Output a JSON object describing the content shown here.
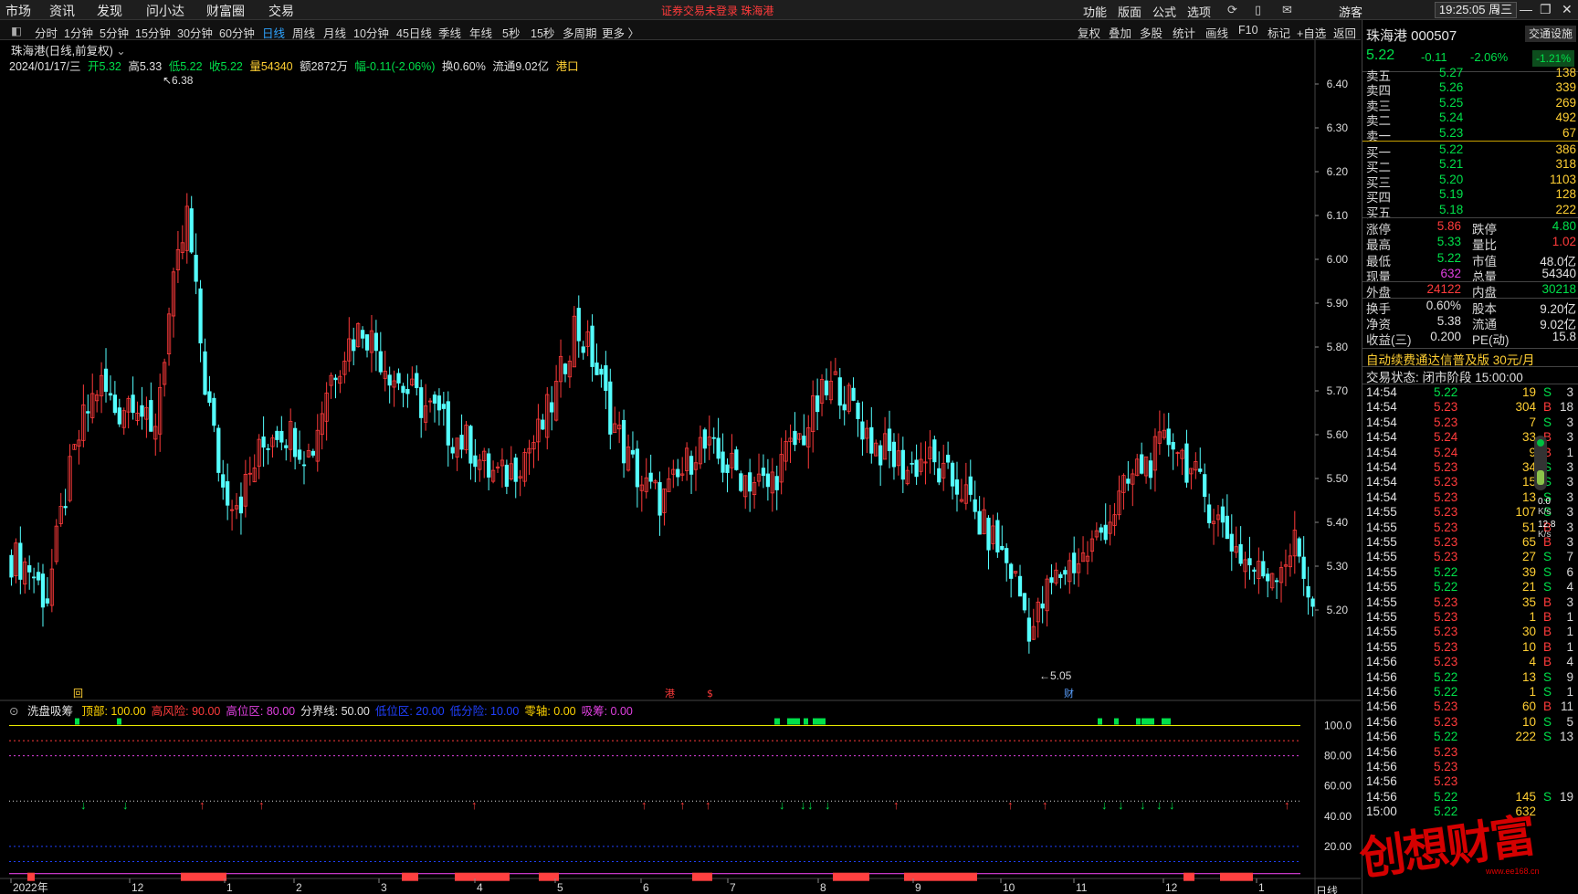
{
  "menu": {
    "left": [
      "市场",
      "资讯",
      "发现",
      "问小达",
      "财富圈",
      "交易"
    ],
    "warning": "证券交易未登录  珠海港",
    "right": [
      "功能",
      "版面",
      "公式",
      "选项"
    ],
    "guest": "游客",
    "clock": "19:25:05 周三"
  },
  "toolbar": {
    "periods": [
      "分时",
      "1分钟",
      "5分钟",
      "15分钟",
      "30分钟",
      "60分钟",
      "日线",
      "周线",
      "月线",
      "10分钟",
      "45日线",
      "季线",
      "年线",
      "5秒",
      "15秒",
      "多周期",
      "更多 〉"
    ],
    "active": "日线",
    "right": [
      "复权",
      "叠加",
      "多股",
      "统计",
      "画线",
      "F10",
      "标记",
      "+自选",
      "返回"
    ]
  },
  "chart": {
    "title": "珠海港(日线,前复权)",
    "date": "2024/01/17/三",
    "open": "开5.32",
    "high": "高5.33",
    "low": "低5.22",
    "close": "收5.22",
    "volume": "量54340",
    "amount": "额2872万",
    "change": "幅-0.11(-2.06%)",
    "turnover": "换0.60%",
    "float": "流通9.02亿",
    "tag": "港口",
    "max_label": "6.38",
    "min_label": "5.05",
    "markers": [
      "回",
      "港",
      "$",
      "财"
    ]
  },
  "indicator": {
    "name": "洗盘吸筹",
    "params": [
      {
        "label": "顶部: 100.00",
        "color": "#ffd400"
      },
      {
        "label": "高风险: 90.00",
        "color": "#ff3b3b"
      },
      {
        "label": "高位区: 80.00",
        "color": "#e040e0"
      },
      {
        "label": "分界线: 50.00",
        "color": "#e0e0e0"
      },
      {
        "label": "低位区: 20.00",
        "color": "#2040ff"
      },
      {
        "label": "低分险: 10.00",
        "color": "#2040ff"
      },
      {
        "label": "零轴: 0.00",
        "color": "#ffd400"
      },
      {
        "label": "吸筹: 0.00",
        "color": "#e040e0"
      }
    ]
  },
  "chart_data": {
    "type": "candlestick",
    "title": "珠海港(日线,前复权)",
    "x_ticks": [
      "2022年",
      "12",
      "1",
      "2",
      "3",
      "4",
      "5",
      "6",
      "7",
      "8",
      "9",
      "10",
      "11",
      "12",
      "1"
    ],
    "ylim": [
      5.0,
      6.45
    ],
    "y_ticks": [
      "6.40",
      "6.30",
      "6.20",
      "6.10",
      "6.00",
      "5.90",
      "5.80",
      "5.70",
      "5.60",
      "5.50",
      "5.40",
      "5.30",
      "5.20"
    ],
    "close_series": [
      5.32,
      5.3,
      5.22,
      5.45,
      5.62,
      5.72,
      5.65,
      5.7,
      5.58,
      5.88,
      6.1,
      5.72,
      5.48,
      5.45,
      5.55,
      5.62,
      5.6,
      5.55,
      5.72,
      5.8,
      5.85,
      5.78,
      5.72,
      5.68,
      5.65,
      5.6,
      5.58,
      5.52,
      5.5,
      5.55,
      5.6,
      5.7,
      5.85,
      5.78,
      5.65,
      5.55,
      5.48,
      5.45,
      5.5,
      5.58,
      5.55,
      5.52,
      5.5,
      5.48,
      5.55,
      5.6,
      5.68,
      5.72,
      5.65,
      5.58,
      5.55,
      5.52,
      5.55,
      5.5,
      5.48,
      5.4,
      5.35,
      5.28,
      5.15,
      5.25,
      5.3,
      5.32,
      5.38,
      5.45,
      5.52,
      5.55,
      5.6,
      5.52,
      5.45,
      5.38,
      5.32,
      5.28,
      5.3,
      5.35,
      5.22
    ],
    "indicator_ylim": [
      0,
      110
    ],
    "indicator_y_ticks": [
      "100.0",
      "80.00",
      "60.00",
      "40.00",
      "20.00"
    ]
  },
  "right": {
    "title": "珠海港 000507",
    "settings": "交通设施",
    "price": "5.22",
    "change": "-0.11",
    "pct": "-2.06%",
    "badge": "-1.21%",
    "asks": [
      {
        "label": "卖五",
        "price": "5.27",
        "vol": "138"
      },
      {
        "label": "卖四",
        "price": "5.26",
        "vol": "339"
      },
      {
        "label": "卖三",
        "price": "5.25",
        "vol": "269"
      },
      {
        "label": "卖二",
        "price": "5.24",
        "vol": "492"
      },
      {
        "label": "卖一",
        "price": "5.23",
        "vol": "67"
      }
    ],
    "bids": [
      {
        "label": "买一",
        "price": "5.22",
        "vol": "386"
      },
      {
        "label": "买二",
        "price": "5.21",
        "vol": "318"
      },
      {
        "label": "买三",
        "price": "5.20",
        "vol": "1103"
      },
      {
        "label": "买四",
        "price": "5.19",
        "vol": "128"
      },
      {
        "label": "买五",
        "price": "5.18",
        "vol": "222"
      }
    ],
    "stats": [
      {
        "a": "涨停",
        "av": "5.86",
        "ac": "red",
        "b": "跌停",
        "bv": "4.80",
        "bc": "green"
      },
      {
        "a": "最高",
        "av": "5.33",
        "ac": "green",
        "b": "量比",
        "bv": "1.02",
        "bc": "red"
      },
      {
        "a": "最低",
        "av": "5.22",
        "ac": "green",
        "b": "市值",
        "bv": "48.0亿",
        "bc": "white"
      },
      {
        "a": "现量",
        "av": "632",
        "ac": "purple",
        "b": "总量",
        "bv": "54340",
        "bc": "white"
      },
      {
        "a": "外盘",
        "av": "24122",
        "ac": "red",
        "b": "内盘",
        "bv": "30218",
        "bc": "green"
      },
      {
        "a": "换手",
        "av": "0.60%",
        "ac": "white",
        "b": "股本",
        "bv": "9.20亿",
        "bc": "white"
      },
      {
        "a": "净资",
        "av": "5.38",
        "ac": "white",
        "b": "流通",
        "bv": "9.02亿",
        "bc": "white"
      },
      {
        "a": "收益(三)",
        "av": "0.200",
        "ac": "white",
        "b": "PE(动)",
        "bv": "15.8",
        "bc": "white"
      }
    ],
    "promo": "自动续费通达信普及版  30元/月",
    "status": "交易状态: 闭市阶段 15:00:00",
    "trades": [
      {
        "t": "14:54",
        "p": "5.22",
        "v": "19",
        "bs": "S",
        "n": "3"
      },
      {
        "t": "14:54",
        "p": "5.23",
        "v": "304",
        "bs": "B",
        "n": "18"
      },
      {
        "t": "14:54",
        "p": "5.23",
        "v": "7",
        "bs": "S",
        "n": "3"
      },
      {
        "t": "14:54",
        "p": "5.24",
        "v": "33",
        "bs": "B",
        "n": "3"
      },
      {
        "t": "14:54",
        "p": "5.24",
        "v": "9",
        "bs": "B",
        "n": "1"
      },
      {
        "t": "14:54",
        "p": "5.23",
        "v": "34",
        "bs": "S",
        "n": "3"
      },
      {
        "t": "14:54",
        "p": "5.23",
        "v": "15",
        "bs": "S",
        "n": "3"
      },
      {
        "t": "14:54",
        "p": "5.23",
        "v": "13",
        "bs": "S",
        "n": "3"
      },
      {
        "t": "14:55",
        "p": "5.23",
        "v": "107",
        "bs": "S",
        "n": "3"
      },
      {
        "t": "14:55",
        "p": "5.23",
        "v": "51",
        "bs": "B",
        "n": "3"
      },
      {
        "t": "14:55",
        "p": "5.23",
        "v": "65",
        "bs": "B",
        "n": "3"
      },
      {
        "t": "14:55",
        "p": "5.23",
        "v": "27",
        "bs": "S",
        "n": "7"
      },
      {
        "t": "14:55",
        "p": "5.22",
        "v": "39",
        "bs": "S",
        "n": "6"
      },
      {
        "t": "14:55",
        "p": "5.22",
        "v": "21",
        "bs": "S",
        "n": "4"
      },
      {
        "t": "14:55",
        "p": "5.23",
        "v": "35",
        "bs": "B",
        "n": "3"
      },
      {
        "t": "14:55",
        "p": "5.23",
        "v": "1",
        "bs": "B",
        "n": "1"
      },
      {
        "t": "14:55",
        "p": "5.23",
        "v": "30",
        "bs": "B",
        "n": "1"
      },
      {
        "t": "14:55",
        "p": "5.23",
        "v": "10",
        "bs": "B",
        "n": "1"
      },
      {
        "t": "14:56",
        "p": "5.23",
        "v": "4",
        "bs": "B",
        "n": "4"
      },
      {
        "t": "14:56",
        "p": "5.22",
        "v": "13",
        "bs": "S",
        "n": "9"
      },
      {
        "t": "14:56",
        "p": "5.22",
        "v": "1",
        "bs": "S",
        "n": "1"
      },
      {
        "t": "14:56",
        "p": "5.23",
        "v": "60",
        "bs": "B",
        "n": "11"
      },
      {
        "t": "14:56",
        "p": "5.23",
        "v": "10",
        "bs": "S",
        "n": "5"
      },
      {
        "t": "14:56",
        "p": "5.22",
        "v": "222",
        "bs": "S",
        "n": "13"
      },
      {
        "t": "14:56",
        "p": "5.23",
        "v": "",
        "bs": "",
        "n": ""
      },
      {
        "t": "14:56",
        "p": "5.23",
        "v": "",
        "bs": "",
        "n": ""
      },
      {
        "t": "14:56",
        "p": "5.23",
        "v": "",
        "bs": "",
        "n": ""
      },
      {
        "t": "14:56",
        "p": "5.22",
        "v": "145",
        "bs": "S",
        "n": "19"
      },
      {
        "t": "15:00",
        "p": "5.22",
        "v": "632",
        "bs": "",
        "n": ""
      }
    ],
    "speed": [
      "0.0",
      "K/s",
      "12.8",
      "K/s"
    ]
  },
  "footer": {
    "period": "日线"
  },
  "watermark": {
    "text": "创想财富",
    "sub": "www.ee168.cn"
  }
}
